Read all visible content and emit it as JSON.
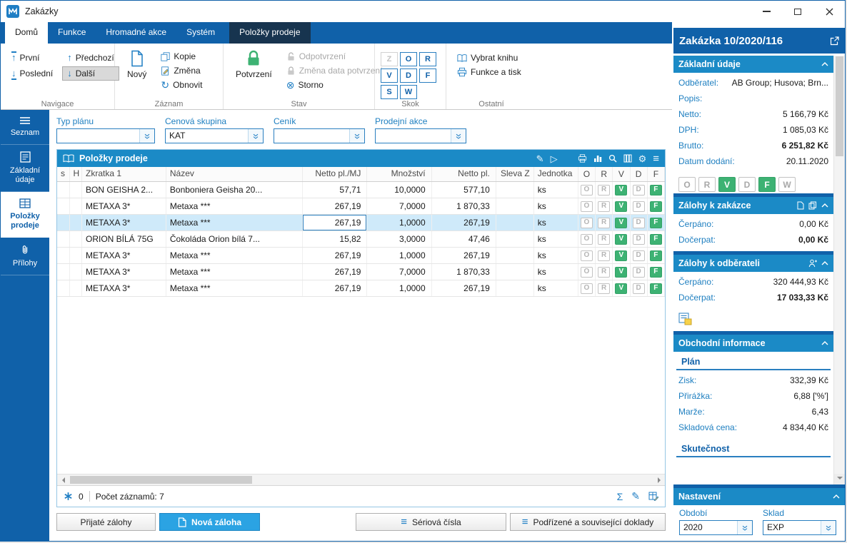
{
  "window": {
    "title": "Zakázky"
  },
  "icons": {
    "sum": "Σ",
    "gear": "⚙",
    "menu": "≡",
    "pencil": "✎",
    "play": "▷",
    "refresh": "↻",
    "storno": "⊗",
    "up": "↑",
    "down": "↓"
  },
  "ribbon": {
    "tabs": [
      {
        "label": "Domů",
        "state": "active"
      },
      {
        "label": "Funkce",
        "state": "normal"
      },
      {
        "label": "Hromadné akce",
        "state": "normal"
      },
      {
        "label": "Systém",
        "state": "normal"
      },
      {
        "label": "Položky prodeje",
        "state": "contextual"
      }
    ],
    "navigace": {
      "label": "Navigace",
      "first": "První",
      "last": "Poslední",
      "prev": "Předchozí",
      "next": "Další"
    },
    "zaznam": {
      "label": "Záznam",
      "new": "Nový",
      "copy": "Kopie",
      "change": "Změna",
      "refresh": "Obnovit"
    },
    "stav": {
      "label": "Stav",
      "confirm": "Potvrzení",
      "unconfirm": "Odpotvrzení",
      "change_date": "Změna data potvrzení",
      "storno": "Storno"
    },
    "skok": {
      "label": "Skok",
      "letters": [
        "Z",
        "O",
        "R",
        "V",
        "D",
        "F",
        "S",
        "W"
      ],
      "disabled_letters": [
        "Z"
      ]
    },
    "ostatni": {
      "label": "Ostatní",
      "select_book": "Vybrat knihu",
      "functions_print": "Funkce a tisk"
    }
  },
  "sidebar": {
    "items": [
      {
        "label": "Seznam",
        "active": false
      },
      {
        "label": "Základní údaje",
        "active": false
      },
      {
        "label": "Položky prodeje",
        "active": true
      },
      {
        "label": "Přílohy",
        "active": false
      }
    ]
  },
  "filters": {
    "typ_planu": {
      "label": "Typ plánu",
      "value": ""
    },
    "cenova_skupina": {
      "label": "Cenová skupina",
      "value": "KAT"
    },
    "cenik": {
      "label": "Ceník",
      "value": ""
    },
    "prodejni_akce": {
      "label": "Prodejní akce",
      "value": ""
    }
  },
  "grid": {
    "title": "Položky prodeje",
    "columns": [
      "s",
      "H",
      "Zkratka 1",
      "Název",
      "Netto pl./MJ",
      "Množství",
      "Netto pl.",
      "Sleva Z",
      "Jednotka",
      "O",
      "R",
      "V",
      "D",
      "F"
    ],
    "selected_row": 2,
    "rows": [
      {
        "zkratka1": "BON GEISHA 2...",
        "nazev": "Bonboniera Geisha 20...",
        "netto_mj": "57,71",
        "mnozstvi": "10,0000",
        "netto": "577,10",
        "sleva_z": "",
        "jednotka": "ks",
        "flags": {
          "O": false,
          "R": false,
          "V": true,
          "D": false,
          "F": true
        }
      },
      {
        "zkratka1": "METAXA 3*",
        "nazev": "Metaxa ***",
        "netto_mj": "267,19",
        "mnozstvi": "7,0000",
        "netto": "1 870,33",
        "sleva_z": "",
        "jednotka": "ks",
        "flags": {
          "O": false,
          "R": false,
          "V": true,
          "D": false,
          "F": true
        }
      },
      {
        "zkratka1": "METAXA 3*",
        "nazev": "Metaxa ***",
        "netto_mj": "267,19",
        "mnozstvi": "1,0000",
        "netto": "267,19",
        "sleva_z": "",
        "jednotka": "ks",
        "flags": {
          "O": false,
          "R": false,
          "V": true,
          "D": false,
          "F": true
        }
      },
      {
        "zkratka1": "ORION BÍLÁ 75G",
        "nazev": "Čokoláda Orion bílá 7...",
        "netto_mj": "15,82",
        "mnozstvi": "3,0000",
        "netto": "47,46",
        "sleva_z": "",
        "jednotka": "ks",
        "flags": {
          "O": false,
          "R": false,
          "V": true,
          "D": false,
          "F": true
        }
      },
      {
        "zkratka1": "METAXA 3*",
        "nazev": "Metaxa ***",
        "netto_mj": "267,19",
        "mnozstvi": "1,0000",
        "netto": "267,19",
        "sleva_z": "",
        "jednotka": "ks",
        "flags": {
          "O": false,
          "R": false,
          "V": true,
          "D": false,
          "F": true
        }
      },
      {
        "zkratka1": "METAXA 3*",
        "nazev": "Metaxa ***",
        "netto_mj": "267,19",
        "mnozstvi": "7,0000",
        "netto": "1 870,33",
        "sleva_z": "",
        "jednotka": "ks",
        "flags": {
          "O": false,
          "R": false,
          "V": true,
          "D": false,
          "F": true
        }
      },
      {
        "zkratka1": "METAXA 3*",
        "nazev": "Metaxa ***",
        "netto_mj": "267,19",
        "mnozstvi": "1,0000",
        "netto": "267,19",
        "sleva_z": "",
        "jednotka": "ks",
        "flags": {
          "O": false,
          "R": false,
          "V": true,
          "D": false,
          "F": true
        }
      }
    ],
    "footer": {
      "counter": "0",
      "record_count": "Počet záznamů: 7"
    }
  },
  "actions": {
    "prijate_zalohy": "Přijaté zálohy",
    "nova_zaloha": "Nová záloha",
    "seriova_cisla": "Sériová čísla",
    "podrizene_doklady": "Podřízené a související doklady"
  },
  "detail": {
    "title": "Zakázka 10/2020/116",
    "zakladni_udaje": {
      "header": "Základní údaje",
      "fields": [
        {
          "label": "Odběratel:",
          "value": "AB Group; Husova; Brn..."
        },
        {
          "label": "Popis:",
          "value": ""
        },
        {
          "label": "Netto:",
          "value": "5 166,79 Kč"
        },
        {
          "label": "DPH:",
          "value": "1 085,03 Kč"
        },
        {
          "label": "Brutto:",
          "value": "6 251,82 Kč",
          "bold": true
        },
        {
          "label": "Datum dodání:",
          "value": "20.11.2020"
        }
      ],
      "flags": {
        "O": false,
        "R": false,
        "V": true,
        "D": false,
        "F": true,
        "W": false
      }
    },
    "zalohy_k_zakazce": {
      "header": "Zálohy k zakázce",
      "fields": [
        {
          "label": "Čerpáno:",
          "value": "0,00 Kč"
        },
        {
          "label": "Dočerpat:",
          "value": "0,00 Kč",
          "bold": true
        }
      ]
    },
    "zalohy_k_odberateli": {
      "header": "Zálohy k odběrateli",
      "fields": [
        {
          "label": "Čerpáno:",
          "value": "320 444,93 Kč"
        },
        {
          "label": "Dočerpat:",
          "value": "17 033,33 Kč",
          "bold": true
        }
      ]
    },
    "obchodni_informace": {
      "header": "Obchodní informace",
      "plan_label": "Plán",
      "fields": [
        {
          "label": "Zisk:",
          "value": "332,39 Kč"
        },
        {
          "label": "Přirážka:",
          "value": "6,88 ['%']"
        },
        {
          "label": "Marže:",
          "value": "6,43"
        },
        {
          "label": "Skladová cena:",
          "value": "4 834,40 Kč"
        }
      ],
      "skutecnost_label": "Skutečnost"
    },
    "nastaveni": {
      "header": "Nastavení",
      "obdobi": {
        "label": "Období",
        "value": "2020"
      },
      "sklad": {
        "label": "Sklad",
        "value": "EXP"
      }
    }
  },
  "colors": {
    "navy": "#1061a9",
    "section_blue": "#1b8ac6",
    "green": "#3db273",
    "selection": "#cfeafa"
  }
}
